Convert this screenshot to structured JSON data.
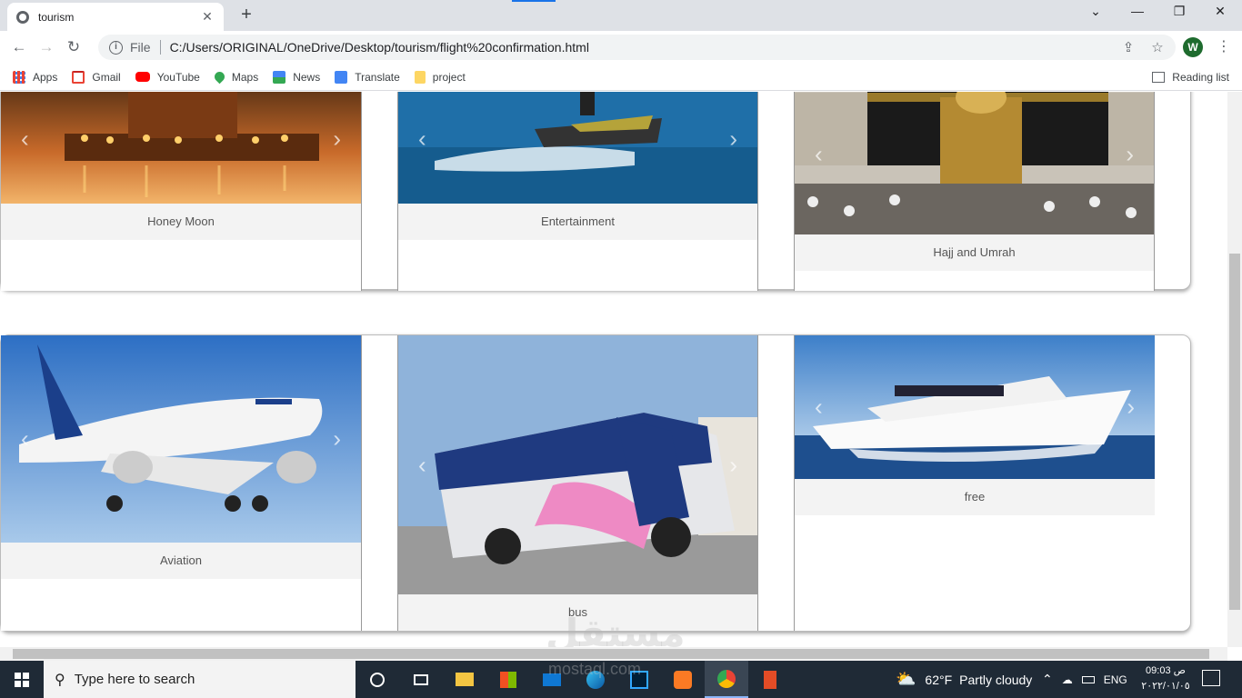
{
  "browser": {
    "tab_title": "tourism",
    "url_scheme_label": "File",
    "url": "C:/Users/ORIGINAL/OneDrive/Desktop/tourism/flight%20confirmation.html",
    "profile_initial": "W"
  },
  "bookmarks": [
    {
      "label": "Apps",
      "icon": "apps-grid-icon"
    },
    {
      "label": "Gmail",
      "icon": "gmail-icon"
    },
    {
      "label": "YouTube",
      "icon": "youtube-icon"
    },
    {
      "label": "Maps",
      "icon": "maps-icon"
    },
    {
      "label": "News",
      "icon": "news-icon"
    },
    {
      "label": "Translate",
      "icon": "translate-icon"
    },
    {
      "label": "project",
      "icon": "folder-icon"
    }
  ],
  "reading_list": "Reading list",
  "rows": [
    {
      "cards": [
        {
          "caption": "Honey Moon",
          "scene": "candle-lit raft on water at sunset"
        },
        {
          "caption": "Entertainment",
          "scene": "jet ski on blue sea"
        },
        {
          "caption": "Hajj and Umrah",
          "scene": "Kaaba with pilgrims"
        }
      ]
    },
    {
      "cards": [
        {
          "caption": "Aviation",
          "scene": "EgyptAir airplane in blue sky"
        },
        {
          "caption": "bus",
          "scene": "tour bus parked"
        },
        {
          "caption": "free",
          "scene": "white yacht on sea"
        }
      ]
    }
  ],
  "taskbar": {
    "search_placeholder": "Type here to search",
    "weather_temp": "62°F",
    "weather_text": "Partly cloudy",
    "language": "ENG",
    "time": "09:03 ص",
    "date": "٢٠٢٢/٠١/٠٥"
  },
  "watermark": {
    "text": "مستقل",
    "subtext": "mostaql.com"
  },
  "colors": {
    "accent": "#1a73e8",
    "taskbar": "#1f2a36",
    "caption_bg": "#f3f3f3"
  }
}
